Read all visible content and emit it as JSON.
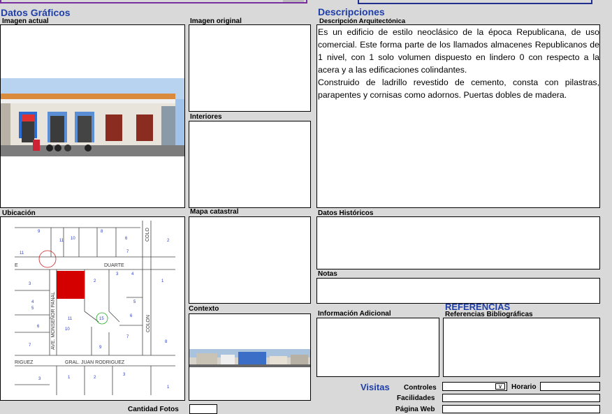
{
  "sections": {
    "datos_graficos": "Datos Gráficos",
    "descripciones": "Descripciones",
    "referencias": "REFERENCIAS",
    "visitas": "Visitas"
  },
  "labels": {
    "imagen_actual": "Imagen actual",
    "imagen_original": "Imagen original",
    "interiores": "Interiores",
    "descripcion_arquitectonica": "Descripción Arquitectónica",
    "ubicacion": "Ubicación",
    "mapa_catastral": "Mapa catastral",
    "datos_historicos": "Datos Históricos",
    "notas": "Notas",
    "contexto": "Contexto",
    "informacion_adicional": "Información Adicional",
    "referencias_bibliograficas": "Referencias Bibliográficas",
    "controles": "Controles",
    "horario": "Horario",
    "facilidades": "Facilidades",
    "pagina_web": "Página Web",
    "cantidad_fotos": "Cantidad Fotos"
  },
  "descripcion": {
    "p1": "Es un edificio de estilo neoclásico de la época Republicana, de uso comercial. Este forma parte de los llamados almacenes Republicanos de 1 nivel, con 1 solo volumen dispuesto en lindero 0 con respecto a la acera y a las edificaciones colindantes.",
    "p2": "Construido de ladrillo revestido de cemento, consta con pilastras, parapentes y cornisas como adornos. Puertas dobles de madera."
  },
  "map": {
    "streets": [
      "DUARTE",
      "GRAL. JUAN RODRIGUEZ",
      "RIGUEZ",
      "AVE. MONSEÑOR PANAL",
      "COLON",
      "COLO",
      "E"
    ],
    "numbers": [
      "9",
      "10",
      "11",
      "8",
      "6",
      "2",
      "7",
      "11",
      "2",
      "3",
      "4",
      "1",
      "3",
      "5",
      "15",
      "6",
      "4",
      "5",
      "11",
      "10",
      "6",
      "7",
      "8",
      "7",
      "9",
      "1",
      "2",
      "3",
      "1",
      "3"
    ]
  },
  "colors": {
    "section_blue": "#1f3fa8",
    "parcel_red": "#d40000",
    "background": "#d9d9d9"
  }
}
